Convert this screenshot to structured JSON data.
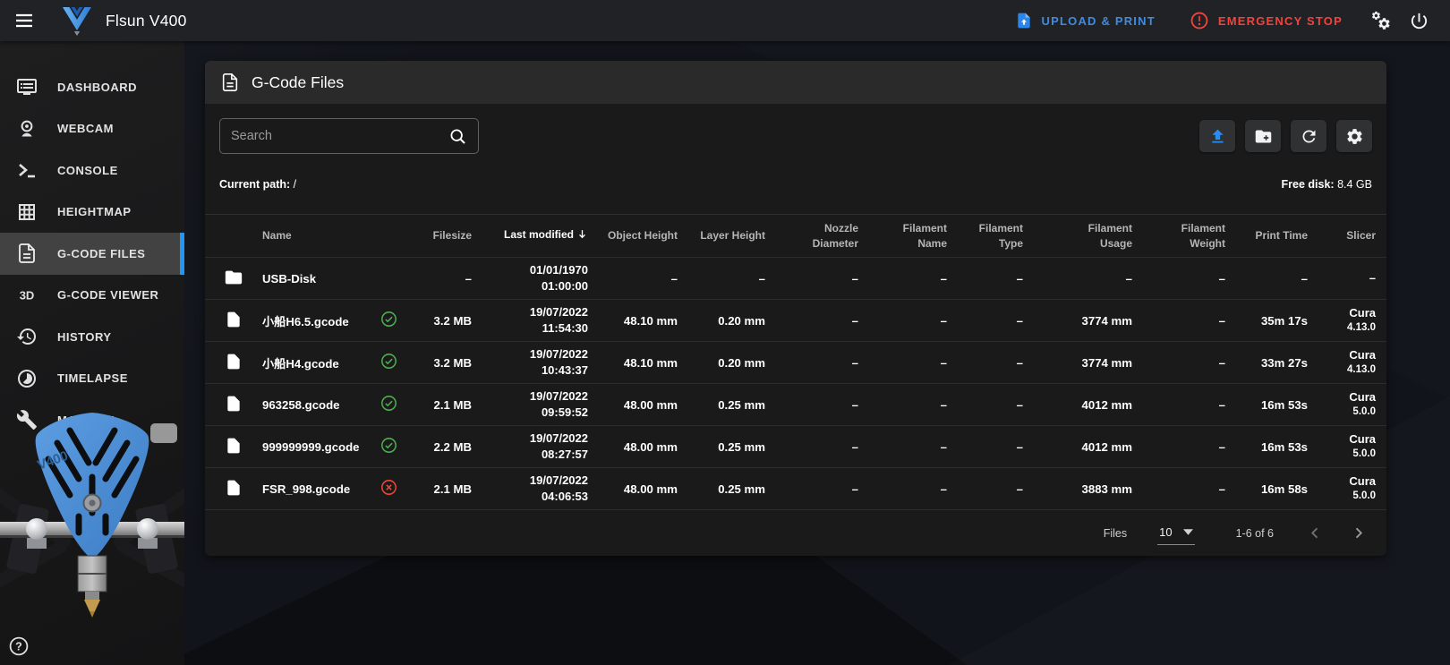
{
  "topbar": {
    "title": "Flsun V400",
    "upload_print_label": "UPLOAD & PRINT",
    "emergency_stop_label": "EMERGENCY STOP"
  },
  "sidebar": {
    "items": [
      {
        "label": "DASHBOARD",
        "icon": "dashboard-icon",
        "active": false
      },
      {
        "label": "WEBCAM",
        "icon": "webcam-icon",
        "active": false
      },
      {
        "label": "CONSOLE",
        "icon": "console-icon",
        "active": false
      },
      {
        "label": "HEIGHTMAP",
        "icon": "heightmap-icon",
        "active": false
      },
      {
        "label": "G-CODE FILES",
        "icon": "gcode-files-icon",
        "active": true
      },
      {
        "label": "G-CODE VIEWER",
        "icon": "gcode-viewer-icon",
        "active": false
      },
      {
        "label": "HISTORY",
        "icon": "history-icon",
        "active": false
      },
      {
        "label": "TIMELAPSE",
        "icon": "timelapse-icon",
        "active": false
      },
      {
        "label": "MACHINE",
        "icon": "machine-icon",
        "active": false
      }
    ],
    "printer_label": "V400"
  },
  "panel": {
    "title": "G-Code Files",
    "search_placeholder": "Search",
    "current_path_label": "Current path:",
    "current_path_value": "/",
    "free_disk_label": "Free disk:",
    "free_disk_value": "8.4 GB"
  },
  "table": {
    "columns": [
      "Name",
      "Filesize",
      "Last modified",
      "Object Height",
      "Layer Height",
      "Nozzle Diameter",
      "Filament Name",
      "Filament Type",
      "Filament Usage",
      "Filament Weight",
      "Print Time",
      "Slicer"
    ],
    "sort_column": "Last modified",
    "sort_direction": "desc",
    "rows": [
      {
        "type": "folder",
        "name": "USB-Disk",
        "status": null,
        "filesize": "–",
        "modified_date": "01/01/1970",
        "modified_time": "01:00:00",
        "object_height": "–",
        "layer_height": "–",
        "nozzle_diameter": "–",
        "filament_name": "–",
        "filament_type": "–",
        "filament_usage": "–",
        "filament_weight": "–",
        "print_time": "–",
        "slicer": "–",
        "slicer_version": ""
      },
      {
        "type": "file",
        "name": "小船H6.5.gcode",
        "status": "ok",
        "filesize": "3.2 MB",
        "modified_date": "19/07/2022",
        "modified_time": "11:54:30",
        "object_height": "48.10 mm",
        "layer_height": "0.20 mm",
        "nozzle_diameter": "–",
        "filament_name": "–",
        "filament_type": "–",
        "filament_usage": "3774 mm",
        "filament_weight": "–",
        "print_time": "35m 17s",
        "slicer": "Cura",
        "slicer_version": "4.13.0"
      },
      {
        "type": "file",
        "name": "小船H4.gcode",
        "status": "ok",
        "filesize": "3.2 MB",
        "modified_date": "19/07/2022",
        "modified_time": "10:43:37",
        "object_height": "48.10 mm",
        "layer_height": "0.20 mm",
        "nozzle_diameter": "–",
        "filament_name": "–",
        "filament_type": "–",
        "filament_usage": "3774 mm",
        "filament_weight": "–",
        "print_time": "33m 27s",
        "slicer": "Cura",
        "slicer_version": "4.13.0"
      },
      {
        "type": "file",
        "name": "963258.gcode",
        "status": "ok",
        "filesize": "2.1 MB",
        "modified_date": "19/07/2022",
        "modified_time": "09:59:52",
        "object_height": "48.00 mm",
        "layer_height": "0.25 mm",
        "nozzle_diameter": "–",
        "filament_name": "–",
        "filament_type": "–",
        "filament_usage": "4012 mm",
        "filament_weight": "–",
        "print_time": "16m 53s",
        "slicer": "Cura",
        "slicer_version": "5.0.0"
      },
      {
        "type": "file",
        "name": "999999999.gcode",
        "status": "ok",
        "filesize": "2.2 MB",
        "modified_date": "19/07/2022",
        "modified_time": "08:27:57",
        "object_height": "48.00 mm",
        "layer_height": "0.25 mm",
        "nozzle_diameter": "–",
        "filament_name": "–",
        "filament_type": "–",
        "filament_usage": "4012 mm",
        "filament_weight": "–",
        "print_time": "16m 53s",
        "slicer": "Cura",
        "slicer_version": "5.0.0"
      },
      {
        "type": "file",
        "name": "FSR_998.gcode",
        "status": "error",
        "filesize": "2.1 MB",
        "modified_date": "19/07/2022",
        "modified_time": "04:06:53",
        "object_height": "48.00 mm",
        "layer_height": "0.25 mm",
        "nozzle_diameter": "–",
        "filament_name": "–",
        "filament_type": "–",
        "filament_usage": "3883 mm",
        "filament_weight": "–",
        "print_time": "16m 58s",
        "slicer": "Cura",
        "slicer_version": "5.0.0"
      }
    ]
  },
  "footer": {
    "files_label": "Files",
    "per_page": "10",
    "range": "1-6 of 6"
  },
  "colors": {
    "accent": "#2196f3",
    "success": "#4caf50",
    "danger": "#f44336"
  }
}
